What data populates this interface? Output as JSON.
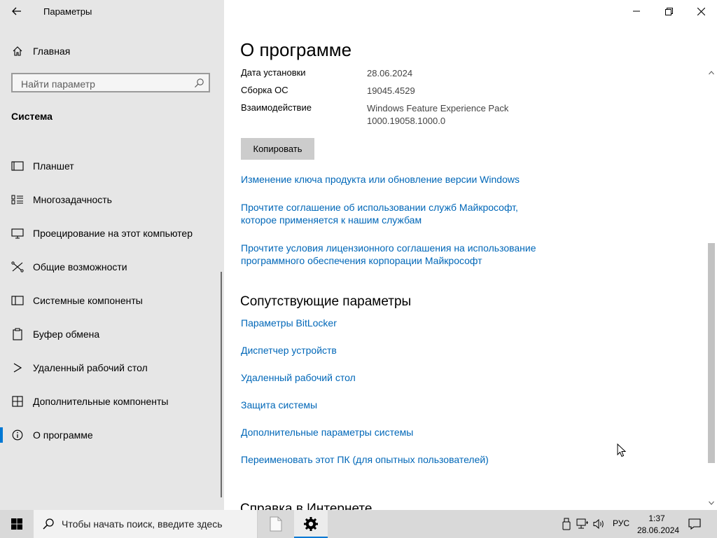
{
  "app": {
    "title": "Параметры"
  },
  "sidebar": {
    "home_label": "Главная",
    "search_placeholder": "Найти параметр",
    "section": "Система",
    "items": [
      {
        "label": "Планшет",
        "icon": "tablet-icon",
        "active": false
      },
      {
        "label": "Многозадачность",
        "icon": "multitasking-icon",
        "active": false
      },
      {
        "label": "Проецирование на этот компьютер",
        "icon": "projecting-icon",
        "active": false
      },
      {
        "label": "Общие возможности",
        "icon": "shared-experiences-icon",
        "active": false
      },
      {
        "label": "Системные компоненты",
        "icon": "system-components-icon",
        "active": false
      },
      {
        "label": "Буфер обмена",
        "icon": "clipboard-icon",
        "active": false
      },
      {
        "label": "Удаленный рабочий стол",
        "icon": "remote-desktop-icon",
        "active": false
      },
      {
        "label": "Дополнительные компоненты",
        "icon": "optional-features-icon",
        "active": false
      },
      {
        "label": "О программе",
        "icon": "info-icon",
        "active": true
      }
    ]
  },
  "main": {
    "title": "О программе",
    "specs": [
      {
        "key": "Дата установки",
        "value": "28.06.2024"
      },
      {
        "key": "Сборка ОС",
        "value": "19045.4529"
      },
      {
        "key": "Взаимодействие",
        "value": "Windows Feature Experience Pack",
        "value2": "1000.19058.1000.0"
      }
    ],
    "copy_button": "Копировать",
    "links": [
      {
        "line1": "Изменение ключа продукта или обновление версии Windows"
      },
      {
        "line1": "Прочтите соглашение об использовании служб Майкрософт,",
        "line2": "которое применяется к нашим службам"
      },
      {
        "line1": "Прочтите условия лицензионного соглашения на использование",
        "line2": "программного обеспечения корпорации Майкрософт"
      }
    ],
    "related_heading": "Сопутствующие параметры",
    "related_links": [
      "Параметры BitLocker",
      "Диспетчер устройств",
      "Удаленный рабочий стол",
      "Защита системы",
      "Дополнительные параметры системы",
      "Переименовать этот ПК (для опытных пользователей)"
    ],
    "web_heading": "Справка в Интернете"
  },
  "taskbar": {
    "search_placeholder": "Чтобы начать поиск, введите здесь",
    "language": "РУС",
    "time": "1:37",
    "date": "28.06.2024"
  },
  "colors": {
    "accent": "#0078d4",
    "link": "#0067b8",
    "sidebar_bg": "#e6e6e6",
    "taskbar_bg": "#d9d9d9"
  }
}
